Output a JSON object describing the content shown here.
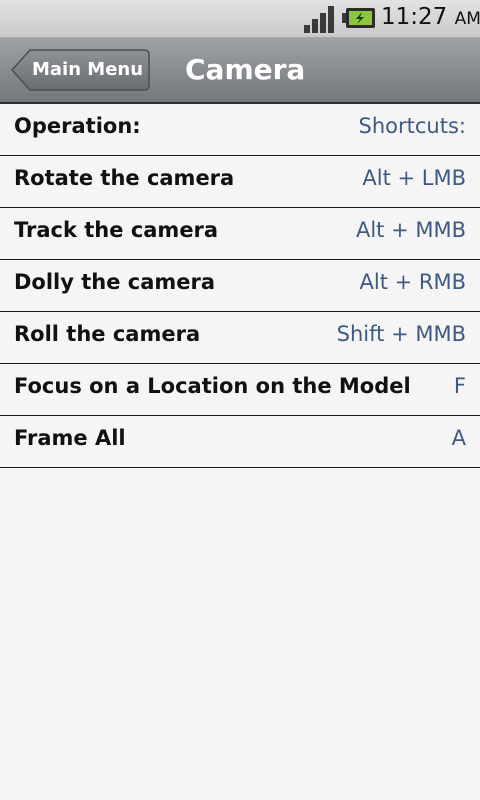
{
  "status_bar": {
    "time": "11:27",
    "ampm": "AM",
    "icons": [
      "signal-icon",
      "battery-charging-icon"
    ]
  },
  "header": {
    "back_label": "Main Menu",
    "title": "Camera"
  },
  "list": {
    "header": {
      "label": "Operation:",
      "value": "Shortcuts:"
    },
    "rows": [
      {
        "label": "Rotate the camera",
        "value": "Alt + LMB"
      },
      {
        "label": "Track the camera",
        "value": "Alt + MMB"
      },
      {
        "label": "Dolly the camera",
        "value": "Alt + RMB"
      },
      {
        "label": "Roll the camera",
        "value": "Shift + MMB"
      },
      {
        "label": "Focus on a Location on the Model",
        "value": "F"
      },
      {
        "label": "Frame All",
        "value": "A"
      }
    ]
  },
  "colors": {
    "value_text": "#3e5a80",
    "battery_green": "#8cc63f",
    "title_bar": "#86898e"
  }
}
